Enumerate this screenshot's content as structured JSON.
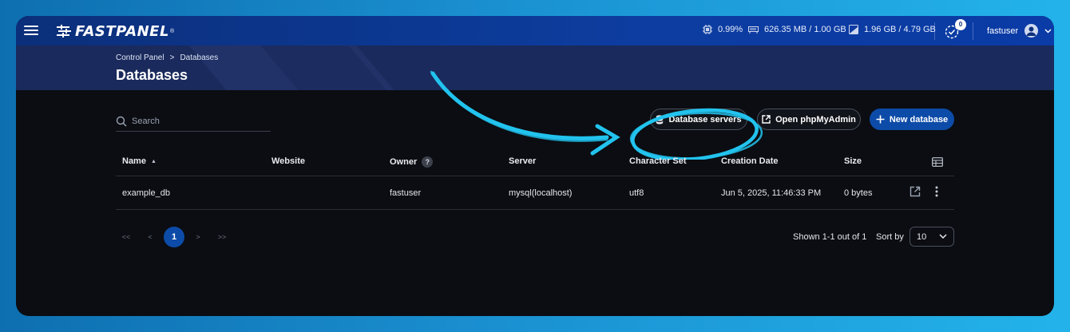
{
  "topbar": {
    "logo_text": "FASTPANEL",
    "logo_reg": "®",
    "cpu": "0.99%",
    "ram": "626.35 MB / 1.00 GB",
    "disk": "1.96 GB / 4.79 GB",
    "notifications_count": "0",
    "username": "fastuser"
  },
  "breadcrumb": {
    "root": "Control Panel",
    "separator": ">",
    "current": "Databases"
  },
  "page_title": "Databases",
  "search": {
    "placeholder": "Search",
    "value": ""
  },
  "actions": {
    "db_servers": "Database servers",
    "phpmyadmin": "Open phpMyAdmin",
    "new_database": "New database"
  },
  "table": {
    "headers": {
      "name": "Name",
      "website": "Website",
      "owner": "Owner",
      "owner_help": "?",
      "server": "Server",
      "charset": "Character Set",
      "created": "Creation Date",
      "size": "Size"
    },
    "rows": [
      {
        "name": "example_db",
        "website": "",
        "owner": "fastuser",
        "server": "mysql(localhost)",
        "charset": "utf8",
        "created": "Jun 5, 2025, 11:46:33 PM",
        "size": "0 bytes"
      }
    ]
  },
  "pagination": {
    "first": "<<",
    "prev": "<",
    "current": "1",
    "next": ">",
    "last": ">>",
    "shown": "Shown 1-1 out of 1",
    "sort_by_label": "Sort by",
    "page_size": "10"
  },
  "colors": {
    "topbar": "#0d3da0",
    "header": "#1a2a5c",
    "background": "#0b0d12",
    "primary": "#0d4ba8",
    "annotation": "#22c3ee"
  }
}
